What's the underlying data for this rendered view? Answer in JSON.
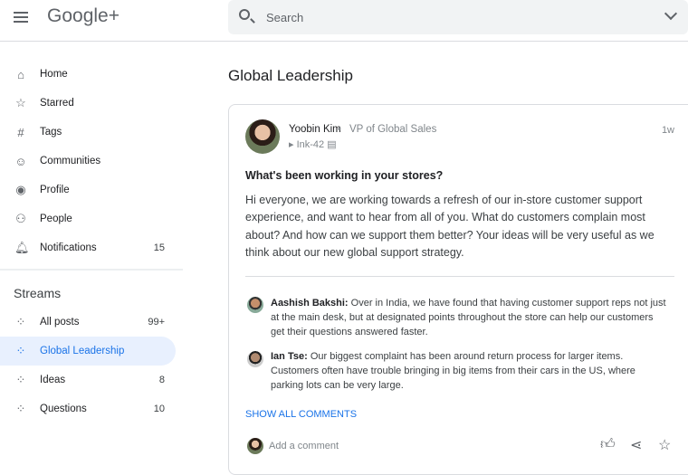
{
  "header": {
    "logo": "Google+",
    "search_placeholder": "Search"
  },
  "nav": [
    {
      "icon": "home-icon",
      "glyph": "⌂",
      "label": "Home",
      "count": ""
    },
    {
      "icon": "star-icon",
      "glyph": "☆",
      "label": "Starred",
      "count": ""
    },
    {
      "icon": "hashtag-icon",
      "glyph": "#",
      "label": "Tags",
      "count": ""
    },
    {
      "icon": "communities-icon",
      "glyph": "☺",
      "label": "Communities",
      "count": ""
    },
    {
      "icon": "profile-icon",
      "glyph": "◉",
      "label": "Profile",
      "count": ""
    },
    {
      "icon": "people-icon",
      "glyph": "⚇",
      "label": "People",
      "count": ""
    },
    {
      "icon": "bell-icon",
      "glyph": "🔔︎",
      "label": "Notifications",
      "count": "15"
    }
  ],
  "streams": {
    "heading": "Streams",
    "items": [
      {
        "label": "All posts",
        "count": "99+",
        "active": false
      },
      {
        "label": "Global Leadership",
        "count": "",
        "active": true
      },
      {
        "label": "Ideas",
        "count": "8",
        "active": false
      },
      {
        "label": "Questions",
        "count": "10",
        "active": false
      }
    ]
  },
  "page_title": "Global Leadership",
  "post": {
    "author": "Yoobin Kim",
    "role": "VP of Global Sales",
    "group": "Ink-42",
    "time": "1w",
    "title": "What's been working in your stores?",
    "body": "Hi everyone, we are working towards a refresh of our in-store customer support experience, and want to hear from all of you. What do customers complain most about? And how can we support them better? Your ideas will be very useful as we think about our new global support strategy.",
    "comments": [
      {
        "author": "Aashish Bakshi:",
        "text": "Over in India, we have found that having customer support reps not just at the main desk, but at designated points throughout the store can help our customers get their questions answered faster."
      },
      {
        "author": "Ian Tse:",
        "text": "Our biggest complaint has been around return process for larger items. Customers often have trouble bringing in big items from their cars in the US, where parking lots can be very large."
      }
    ],
    "show_all": "SHOW ALL COMMENTS",
    "add_comment": "Add a comment"
  },
  "colors": {
    "accent": "#1a73e8",
    "active_bg": "#e8f0fe"
  }
}
